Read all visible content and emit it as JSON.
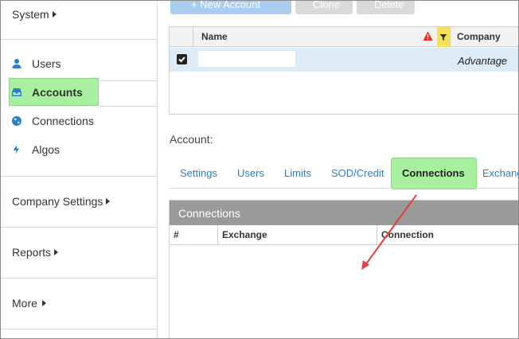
{
  "sidebar": {
    "system": "System",
    "items": [
      {
        "label": "Users",
        "icon": "user-icon"
      },
      {
        "label": "Accounts",
        "icon": "inbox-icon"
      },
      {
        "label": "Connections",
        "icon": "globe-icon"
      },
      {
        "label": "Algos",
        "icon": "bolt-icon"
      }
    ],
    "company_settings": "Company Settings",
    "reports": "Reports",
    "more": "More",
    "highlight_color": "#a8f0a0"
  },
  "toolbar": {
    "new_account": "+ New Account",
    "clone": "Clone",
    "delete": "Delete"
  },
  "grid": {
    "columns": [
      "Name",
      "Company"
    ],
    "rows": [
      {
        "checked": true,
        "name": "",
        "company": "Advantage"
      }
    ]
  },
  "account": {
    "label": "Account:"
  },
  "tabs": [
    "Settings",
    "Users",
    "Limits",
    "SOD/Credit",
    "Connections",
    "Exchang"
  ],
  "active_tab": "Connections",
  "connections_panel": {
    "title": "Connections",
    "columns": [
      "#",
      "Exchange",
      "Connection"
    ]
  },
  "colors": {
    "accent": "#2a7fc4",
    "panel_header": "#9a9a9a",
    "selected_row": "#dcebf6",
    "annotation_arrow": "#e0403a"
  }
}
